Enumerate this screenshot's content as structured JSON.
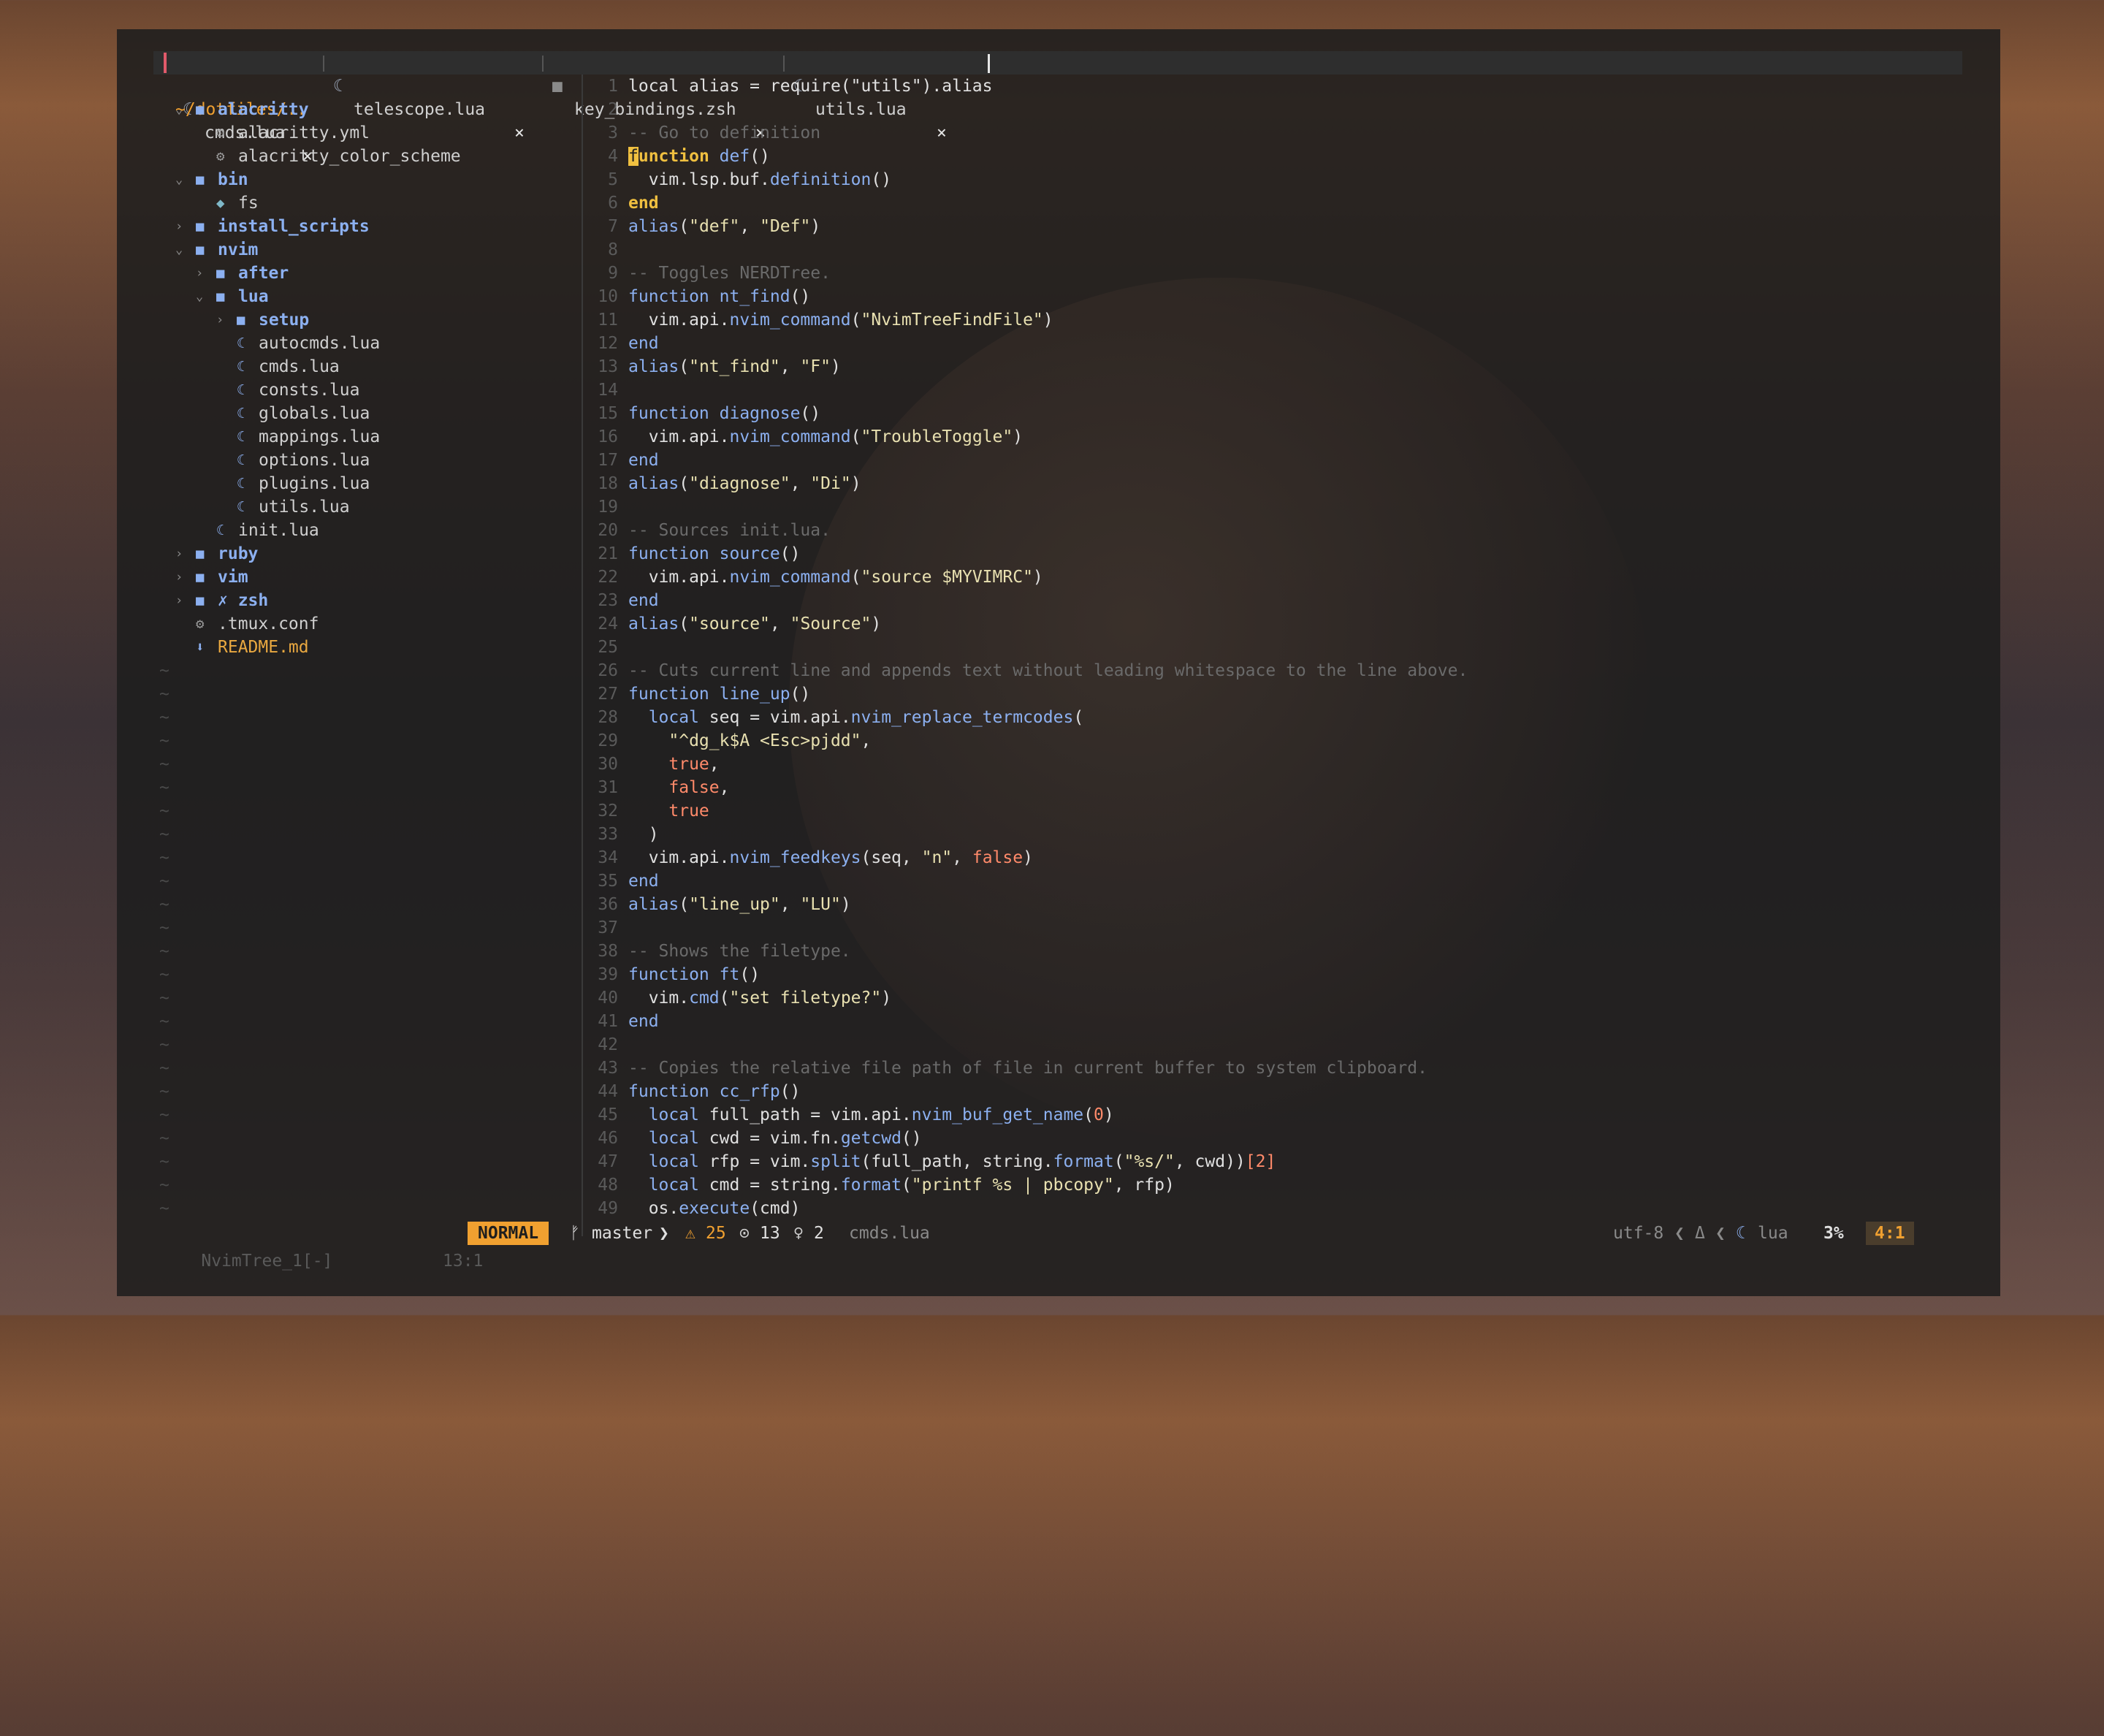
{
  "tabs": [
    {
      "label": "cmds.lua",
      "icon": "lua-icon",
      "active": true
    },
    {
      "label": "telescope.lua",
      "icon": "lua-icon",
      "active": false
    },
    {
      "label": "key_bindings.zsh",
      "icon": "terminal-file-icon",
      "active": false
    },
    {
      "label": "utils.lua",
      "icon": "lua-icon",
      "active": false
    }
  ],
  "tab_close_glyph": "×",
  "tree": {
    "root": "~/dotfiles/..",
    "items": [
      {
        "indent": 0,
        "arrow": "⌄",
        "icon": "📁",
        "name": "alacritty",
        "kind": "folder"
      },
      {
        "indent": 1,
        "arrow": "",
        "icon": "⚙",
        "name": "alacritty.yml",
        "kind": "file"
      },
      {
        "indent": 1,
        "arrow": "",
        "icon": "⚙",
        "name": "alacritty_color_scheme",
        "kind": "file"
      },
      {
        "indent": 0,
        "arrow": "⌄",
        "icon": "📁",
        "name": "bin",
        "kind": "folder"
      },
      {
        "indent": 1,
        "arrow": "",
        "icon": "◆",
        "name": "fs",
        "kind": "file"
      },
      {
        "indent": 0,
        "arrow": "›",
        "icon": "📁",
        "name": "install_scripts",
        "kind": "folder"
      },
      {
        "indent": 0,
        "arrow": "⌄",
        "icon": "📁",
        "name": "nvim",
        "kind": "folder"
      },
      {
        "indent": 1,
        "arrow": "›",
        "icon": "📁",
        "name": "after",
        "kind": "folder"
      },
      {
        "indent": 1,
        "arrow": "⌄",
        "icon": "📁",
        "name": "lua",
        "kind": "folder"
      },
      {
        "indent": 2,
        "arrow": "›",
        "icon": "📁",
        "name": "setup",
        "kind": "folder"
      },
      {
        "indent": 2,
        "arrow": "",
        "icon": "☾",
        "name": "autocmds.lua",
        "kind": "file"
      },
      {
        "indent": 2,
        "arrow": "",
        "icon": "☾",
        "name": "cmds.lua",
        "kind": "file"
      },
      {
        "indent": 2,
        "arrow": "",
        "icon": "☾",
        "name": "consts.lua",
        "kind": "file"
      },
      {
        "indent": 2,
        "arrow": "",
        "icon": "☾",
        "name": "globals.lua",
        "kind": "file"
      },
      {
        "indent": 2,
        "arrow": "",
        "icon": "☾",
        "name": "mappings.lua",
        "kind": "file"
      },
      {
        "indent": 2,
        "arrow": "",
        "icon": "☾",
        "name": "options.lua",
        "kind": "file"
      },
      {
        "indent": 2,
        "arrow": "",
        "icon": "☾",
        "name": "plugins.lua",
        "kind": "file"
      },
      {
        "indent": 2,
        "arrow": "",
        "icon": "☾",
        "name": "utils.lua",
        "kind": "file"
      },
      {
        "indent": 1,
        "arrow": "",
        "icon": "☾",
        "name": "init.lua",
        "kind": "file"
      },
      {
        "indent": 0,
        "arrow": "›",
        "icon": "📁",
        "name": "ruby",
        "kind": "folder"
      },
      {
        "indent": 0,
        "arrow": "›",
        "icon": "📁",
        "name": "vim",
        "kind": "folder"
      },
      {
        "indent": 0,
        "arrow": "›",
        "icon": "📁",
        "name": "✗ zsh",
        "kind": "folder"
      },
      {
        "indent": 0,
        "arrow": "",
        "icon": "⚙",
        "name": ".tmux.conf",
        "kind": "file"
      },
      {
        "indent": 0,
        "arrow": "",
        "icon": "⬇",
        "name": "README.md",
        "kind": "readme"
      }
    ],
    "tilde_rows": 24
  },
  "code": [
    [
      [
        "p",
        "local alias = require(\"utils\").alias"
      ]
    ],
    [],
    [
      [
        "c",
        "-- Go to definition"
      ]
    ],
    [
      [
        "cur",
        "f"
      ],
      [
        "k",
        "unction"
      ],
      [
        "p",
        " "
      ],
      [
        "fn",
        "def"
      ],
      [
        "p",
        "()"
      ]
    ],
    [
      [
        "p",
        "  vim.lsp.buf."
      ],
      [
        "fn",
        "definition"
      ],
      [
        "p",
        "()"
      ]
    ],
    [
      [
        "k",
        "end"
      ]
    ],
    [
      [
        "fn",
        "alias"
      ],
      [
        "p",
        "("
      ],
      [
        "s",
        "\"def\""
      ],
      [
        "p",
        ", "
      ],
      [
        "s",
        "\"Def\""
      ],
      [
        "p",
        ")"
      ]
    ],
    [],
    [
      [
        "c",
        "-- Toggles NERDTree."
      ]
    ],
    [
      [
        "kw",
        "function"
      ],
      [
        "p",
        " "
      ],
      [
        "fn",
        "nt_find"
      ],
      [
        "p",
        "()"
      ]
    ],
    [
      [
        "p",
        "  vim.api."
      ],
      [
        "fn",
        "nvim_command"
      ],
      [
        "p",
        "("
      ],
      [
        "s",
        "\"NvimTreeFindFile\""
      ],
      [
        "p",
        ")"
      ]
    ],
    [
      [
        "kw",
        "end"
      ]
    ],
    [
      [
        "fn",
        "alias"
      ],
      [
        "p",
        "("
      ],
      [
        "s",
        "\"nt_find\""
      ],
      [
        "p",
        ", "
      ],
      [
        "s",
        "\"F\""
      ],
      [
        "p",
        ")"
      ]
    ],
    [],
    [
      [
        "kw",
        "function"
      ],
      [
        "p",
        " "
      ],
      [
        "fn",
        "diagnose"
      ],
      [
        "p",
        "()"
      ]
    ],
    [
      [
        "p",
        "  vim.api."
      ],
      [
        "fn",
        "nvim_command"
      ],
      [
        "p",
        "("
      ],
      [
        "s",
        "\"TroubleToggle\""
      ],
      [
        "p",
        ")"
      ]
    ],
    [
      [
        "kw",
        "end"
      ]
    ],
    [
      [
        "fn",
        "alias"
      ],
      [
        "p",
        "("
      ],
      [
        "s",
        "\"diagnose\""
      ],
      [
        "p",
        ", "
      ],
      [
        "s",
        "\"Di\""
      ],
      [
        "p",
        ")"
      ]
    ],
    [],
    [
      [
        "c",
        "-- Sources init.lua."
      ]
    ],
    [
      [
        "kw",
        "function"
      ],
      [
        "p",
        " "
      ],
      [
        "fn",
        "source"
      ],
      [
        "p",
        "()"
      ]
    ],
    [
      [
        "p",
        "  vim.api."
      ],
      [
        "fn",
        "nvim_command"
      ],
      [
        "p",
        "("
      ],
      [
        "s",
        "\"source $MYVIMRC\""
      ],
      [
        "p",
        ")"
      ]
    ],
    [
      [
        "kw",
        "end"
      ]
    ],
    [
      [
        "fn",
        "alias"
      ],
      [
        "p",
        "("
      ],
      [
        "s",
        "\"source\""
      ],
      [
        "p",
        ", "
      ],
      [
        "s",
        "\"Source\""
      ],
      [
        "p",
        ")"
      ]
    ],
    [],
    [
      [
        "c",
        "-- Cuts current line and appends text without leading whitespace to the line above."
      ]
    ],
    [
      [
        "kw",
        "function"
      ],
      [
        "p",
        " "
      ],
      [
        "fn",
        "line_up"
      ],
      [
        "p",
        "()"
      ]
    ],
    [
      [
        "p",
        "  "
      ],
      [
        "kw",
        "local"
      ],
      [
        "p",
        " seq = vim.api."
      ],
      [
        "fn",
        "nvim_replace_termcodes"
      ],
      [
        "p",
        "("
      ]
    ],
    [
      [
        "p",
        "    "
      ],
      [
        "s",
        "\"^dg_k$A <Esc>pjdd\""
      ],
      [
        "p",
        ","
      ]
    ],
    [
      [
        "p",
        "    "
      ],
      [
        "b",
        "true"
      ],
      [
        "p",
        ","
      ]
    ],
    [
      [
        "p",
        "    "
      ],
      [
        "b",
        "false"
      ],
      [
        "p",
        ","
      ]
    ],
    [
      [
        "p",
        "    "
      ],
      [
        "b",
        "true"
      ]
    ],
    [
      [
        "p",
        "  )"
      ]
    ],
    [
      [
        "p",
        "  vim.api."
      ],
      [
        "fn",
        "nvim_feedkeys"
      ],
      [
        "p",
        "(seq, "
      ],
      [
        "s",
        "\"n\""
      ],
      [
        "p",
        ", "
      ],
      [
        "b",
        "false"
      ],
      [
        "p",
        ")"
      ]
    ],
    [
      [
        "kw",
        "end"
      ]
    ],
    [
      [
        "fn",
        "alias"
      ],
      [
        "p",
        "("
      ],
      [
        "s",
        "\"line_up\""
      ],
      [
        "p",
        ", "
      ],
      [
        "s",
        "\"LU\""
      ],
      [
        "p",
        ")"
      ]
    ],
    [],
    [
      [
        "c",
        "-- Shows the filetype."
      ]
    ],
    [
      [
        "kw",
        "function"
      ],
      [
        "p",
        " "
      ],
      [
        "fn",
        "ft"
      ],
      [
        "p",
        "()"
      ]
    ],
    [
      [
        "p",
        "  vim."
      ],
      [
        "fn",
        "cmd"
      ],
      [
        "p",
        "("
      ],
      [
        "s",
        "\"set filetype?\""
      ],
      [
        "p",
        ")"
      ]
    ],
    [
      [
        "kw",
        "end"
      ]
    ],
    [],
    [
      [
        "c",
        "-- Copies the relative file path of file in current buffer to system clipboard."
      ]
    ],
    [
      [
        "kw",
        "function"
      ],
      [
        "p",
        " "
      ],
      [
        "fn",
        "cc_rfp"
      ],
      [
        "p",
        "()"
      ]
    ],
    [
      [
        "p",
        "  "
      ],
      [
        "kw",
        "local"
      ],
      [
        "p",
        " full_path = vim.api."
      ],
      [
        "fn",
        "nvim_buf_get_name"
      ],
      [
        "p",
        "("
      ],
      [
        "b",
        "0"
      ],
      [
        "p",
        ")"
      ]
    ],
    [
      [
        "p",
        "  "
      ],
      [
        "kw",
        "local"
      ],
      [
        "p",
        " cwd = vim.fn."
      ],
      [
        "fn",
        "getcwd"
      ],
      [
        "p",
        "()"
      ]
    ],
    [
      [
        "p",
        "  "
      ],
      [
        "kw",
        "local"
      ],
      [
        "p",
        " rfp = vim."
      ],
      [
        "fn",
        "split"
      ],
      [
        "p",
        "(full_path, string."
      ],
      [
        "fn",
        "format"
      ],
      [
        "p",
        "("
      ],
      [
        "s",
        "\"%s/\""
      ],
      [
        "p",
        ", cwd))"
      ],
      [
        "b",
        "[2]"
      ]
    ],
    [
      [
        "p",
        "  "
      ],
      [
        "kw",
        "local"
      ],
      [
        "p",
        " cmd = string."
      ],
      [
        "fn",
        "format"
      ],
      [
        "p",
        "("
      ],
      [
        "s",
        "\"printf %s | pbcopy\""
      ],
      [
        "p",
        ", rfp)"
      ]
    ],
    [
      [
        "p",
        "  os."
      ],
      [
        "fn",
        "execute"
      ],
      [
        "p",
        "(cmd)"
      ]
    ]
  ],
  "status": {
    "tree_buffer": "NvimTree_1[-]",
    "tree_pos": "13:1",
    "mode": "NORMAL",
    "branch_icon": "",
    "branch": "master",
    "warnings": "25",
    "info": "13",
    "hints": "2",
    "file": "cmds.lua",
    "encoding": "utf-8",
    "filetype": "lua",
    "percent": "3%",
    "position": "4:1"
  },
  "colors": {
    "accent": "#f0a030",
    "folder": "#8cb0f0",
    "active_tab_marker": "#e05a6a"
  }
}
